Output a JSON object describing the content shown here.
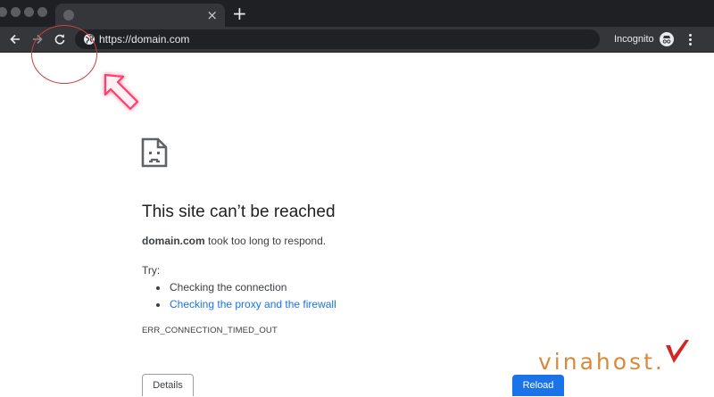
{
  "browser": {
    "url": "https://domain.com",
    "tab_close": "×",
    "new_tab": "+",
    "incognito_label": "Incognito",
    "icons": {
      "back": "back-arrow-icon",
      "forward": "forward-arrow-icon",
      "reload": "reload-icon",
      "site_info": "globe-icon",
      "incognito": "incognito-icon",
      "menu": "kebab-menu-icon"
    }
  },
  "error_page": {
    "title": "This site can’t be reached",
    "message_domain": "domain.com",
    "message_rest": " took too long to respond.",
    "try_label": "Try:",
    "suggestions": [
      {
        "text": "Checking the connection",
        "is_link": false
      },
      {
        "text": "Checking the proxy and the firewall",
        "is_link": true
      }
    ],
    "error_code": "ERR_CONNECTION_TIMED_OUT",
    "details_button": "Details",
    "reload_button": "Reload",
    "icon": "broken-page-icon"
  },
  "watermark": {
    "text": "vinahost."
  },
  "colors": {
    "chrome_dark": "#1f2023",
    "toolbar": "#35363a",
    "link_blue": "#1a73e8",
    "annotation_red": "#c94040",
    "arrow_pink": "#ff3d6e",
    "watermark_orange": "#d68a3a",
    "watermark_red": "#d42525"
  }
}
